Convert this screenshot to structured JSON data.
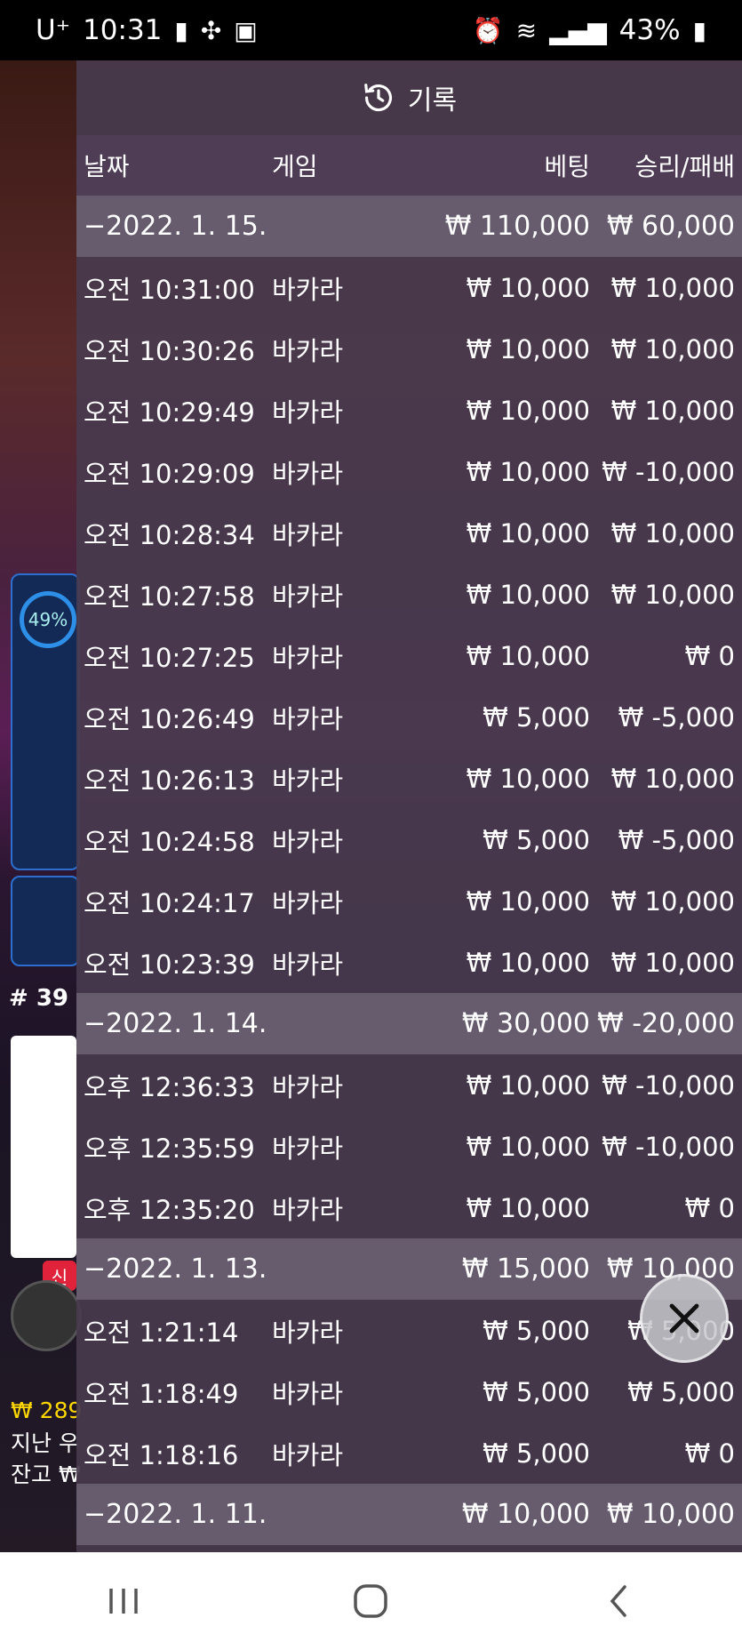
{
  "status": {
    "carrier": "U⁺",
    "time": "10:31",
    "battery": "43%"
  },
  "background": {
    "percent": "49%",
    "round": "# 39",
    "badge": "신",
    "balance1": "₩ 289",
    "balance2": "지난 우",
    "balance3": "잔고 ₩"
  },
  "history": {
    "title": "기록",
    "columns": {
      "date": "날짜",
      "game": "게임",
      "bet": "베팅",
      "win": "승리/패배"
    },
    "groups": [
      {
        "date": "−2022. 1. 15.",
        "bet": "₩ 110,000",
        "win": "₩ 60,000",
        "rows": [
          {
            "time": "오전 10:31:00",
            "game": "바카라",
            "bet": "₩ 10,000",
            "win": "₩ 10,000"
          },
          {
            "time": "오전 10:30:26",
            "game": "바카라",
            "bet": "₩ 10,000",
            "win": "₩ 10,000"
          },
          {
            "time": "오전 10:29:49",
            "game": "바카라",
            "bet": "₩ 10,000",
            "win": "₩ 10,000"
          },
          {
            "time": "오전 10:29:09",
            "game": "바카라",
            "bet": "₩ 10,000",
            "win": "₩ -10,000"
          },
          {
            "time": "오전 10:28:34",
            "game": "바카라",
            "bet": "₩ 10,000",
            "win": "₩ 10,000"
          },
          {
            "time": "오전 10:27:58",
            "game": "바카라",
            "bet": "₩ 10,000",
            "win": "₩ 10,000"
          },
          {
            "time": "오전 10:27:25",
            "game": "바카라",
            "bet": "₩ 10,000",
            "win": "₩ 0"
          },
          {
            "time": "오전 10:26:49",
            "game": "바카라",
            "bet": "₩ 5,000",
            "win": "₩ -5,000"
          },
          {
            "time": "오전 10:26:13",
            "game": "바카라",
            "bet": "₩ 10,000",
            "win": "₩ 10,000"
          },
          {
            "time": "오전 10:24:58",
            "game": "바카라",
            "bet": "₩ 5,000",
            "win": "₩ -5,000"
          },
          {
            "time": "오전 10:24:17",
            "game": "바카라",
            "bet": "₩ 10,000",
            "win": "₩ 10,000"
          },
          {
            "time": "오전 10:23:39",
            "game": "바카라",
            "bet": "₩ 10,000",
            "win": "₩ 10,000"
          }
        ]
      },
      {
        "date": "−2022. 1. 14.",
        "bet": "₩ 30,000",
        "win": "₩ -20,000",
        "rows": [
          {
            "time": "오후 12:36:33",
            "game": "바카라",
            "bet": "₩ 10,000",
            "win": "₩ -10,000"
          },
          {
            "time": "오후 12:35:59",
            "game": "바카라",
            "bet": "₩ 10,000",
            "win": "₩ -10,000"
          },
          {
            "time": "오후 12:35:20",
            "game": "바카라",
            "bet": "₩ 10,000",
            "win": "₩ 0"
          }
        ]
      },
      {
        "date": "−2022. 1. 13.",
        "bet": "₩ 15,000",
        "win": "₩ 10,000",
        "rows": [
          {
            "time": "오전 1:21:14",
            "game": "바카라",
            "bet": "₩ 5,000",
            "win": "₩ 5,000"
          },
          {
            "time": "오전 1:18:49",
            "game": "바카라",
            "bet": "₩ 5,000",
            "win": "₩ 5,000"
          },
          {
            "time": "오전 1:18:16",
            "game": "바카라",
            "bet": "₩ 5,000",
            "win": "₩ 0"
          }
        ]
      },
      {
        "date": "−2022. 1. 11.",
        "bet": "₩ 10,000",
        "win": "₩ 10,000",
        "rows": []
      }
    ]
  },
  "icons": {
    "history": "history-clock-icon",
    "close": "close-icon"
  }
}
